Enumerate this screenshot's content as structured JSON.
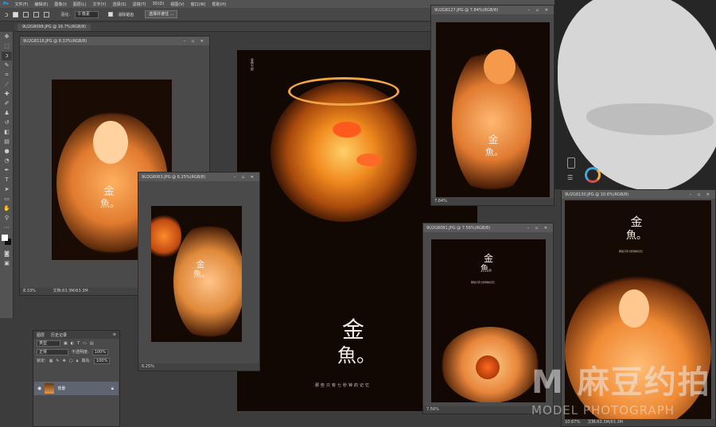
{
  "menu": [
    "文件(F)",
    "编辑(E)",
    "图像(I)",
    "图层(L)",
    "文字(Y)",
    "选择(S)",
    "滤镜(T)",
    "3D(D)",
    "视图(V)",
    "窗口(W)",
    "帮助(H)"
  ],
  "options": {
    "feather_label": "羽化:",
    "feather_value": "0 像素",
    "antialias_label": "消除锯齿",
    "select_mask_button": "选择并遮住 ..."
  },
  "doc_tab": "9U2G8098.JPG @ 16.7%(RGB/8)",
  "windows": {
    "w1": {
      "title": "9U2G8116.JPG @ 8.33%(RGB/8)",
      "zoom": "8.33%",
      "doc_size": "文档:63.3M/63.3M"
    },
    "w2": {
      "title": "9U2G8063.JPG @ 6.25%(RGB/8)",
      "zoom": "6.25%"
    },
    "w3": {
      "title": "9U2G8127.JPG @ 7.84%(RGB/8)",
      "zoom": "7.84%"
    },
    "w4": {
      "title": "9U2G8081.JPG @ 7.56%(RGB/8)",
      "zoom": "7.56%"
    },
    "w5": {
      "title": "9U2G8130.JPG @ 10.6%(RGB/8)",
      "zoom": "10.67%",
      "doc_size": "文档:63.3M/63.3M"
    }
  },
  "poster": {
    "title_top": "金",
    "title_bottom": "魚。",
    "subtitle": "那些只有七秒钟的记忆"
  },
  "layers_panel": {
    "tabs": [
      "图层",
      "历史记录"
    ],
    "filter": "类型",
    "blend_mode": "正常",
    "opacity_label": "不透明度:",
    "opacity_value": "100%",
    "lock_label": "锁定:",
    "fill_label": "填充:",
    "fill_value": "100%",
    "layer_name": "背景"
  },
  "watermark": {
    "brand": "M 麻豆约拍",
    "sub": "MODEL PHOTOGRAPH"
  },
  "colors": {
    "glow": "#ff9a3a",
    "dark": "#120804",
    "ui_bg": "#3c3c3c"
  }
}
